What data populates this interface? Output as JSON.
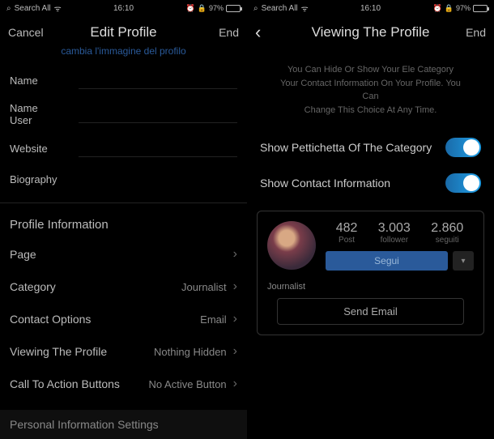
{
  "status": {
    "search": "Search All",
    "time": "16:10",
    "battery": "97%"
  },
  "left": {
    "nav": {
      "cancel": "Cancel",
      "title": "Edit Profile",
      "end": "End"
    },
    "change_photo": "cambia l'immagine del profilo",
    "fields": {
      "name": "Name",
      "username_label": "Name",
      "username_value": "User",
      "website": "Website",
      "biography": "Biography"
    },
    "section": "Profile Information",
    "rows": {
      "page": {
        "label": "Page"
      },
      "category": {
        "label": "Category",
        "value": "Journalist"
      },
      "contact": {
        "label": "Contact Options",
        "value": "Email"
      },
      "viewing": {
        "label": "Viewing The Profile",
        "value": "Nothing Hidden"
      },
      "cta": {
        "label": "Call To Action Buttons",
        "value": "No Active Button"
      }
    },
    "footer": "Personal Information Settings"
  },
  "right": {
    "nav": {
      "title": "Viewing The Profile",
      "end": "End"
    },
    "info1": "You Can Hide Or Show Your Ele Category",
    "info2": "Your Contact Information On Your Profile. You Can",
    "info3": "Change This Choice At Any Time.",
    "toggle1": "Show Pettichetta Of The Category",
    "toggle2": "Show Contact Information",
    "profile": {
      "stats": {
        "posts_n": "482",
        "posts_l": "Post",
        "followers_n": "3.003",
        "followers_l": "follower",
        "following_n": "2.860",
        "following_l": "seguiti"
      },
      "follow": "Segui",
      "role": "Journalist",
      "send_email": "Send Email"
    }
  }
}
